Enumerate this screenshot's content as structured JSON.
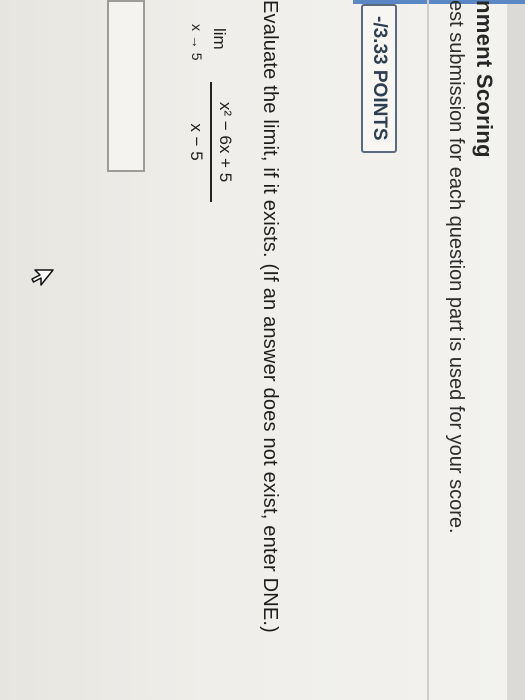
{
  "assignment": {
    "title": "nment Scoring",
    "scoring_note": "est submission for each question part is used for your score."
  },
  "question": {
    "points": "-/3.33 POINTS",
    "prompt": "Evaluate the limit, if it exists. (If an answer does not exist, enter DNE.)",
    "limit": {
      "operator": "lim",
      "approach": "x → 5",
      "numerator": "x² − 6x + 5",
      "denominator": "x − 5"
    },
    "answer_value": ""
  },
  "colors": {
    "accent_bar": "#5b87c4",
    "badge_border": "#5c6b7b"
  },
  "icons": [
    "cursor-arrow-icon"
  ]
}
